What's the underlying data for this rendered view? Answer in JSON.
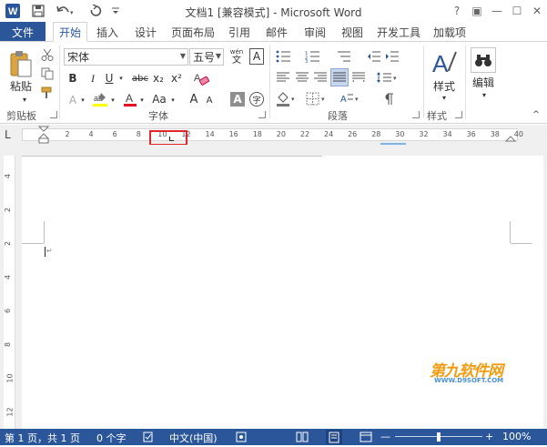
{
  "window": {
    "title": "文档1 [兼容模式] - Microsoft Word",
    "controls": [
      "?",
      "▣",
      "—",
      "☐",
      "✕"
    ]
  },
  "tabs": {
    "file": "文件",
    "items": [
      "开始",
      "插入",
      "设计",
      "页面布局",
      "引用",
      "邮件",
      "审阅",
      "视图",
      "开发工具",
      "加载项"
    ],
    "active_index": 0
  },
  "ribbon": {
    "clipboard": {
      "paste": "粘贴",
      "label": "剪贴板"
    },
    "font": {
      "family": "宋体",
      "size": "五号",
      "phonetic_top": "wén",
      "phonetic_bottom": "文",
      "border_char": "A",
      "bold": "B",
      "italic": "I",
      "underline": "U",
      "strike": "abc",
      "subscript": "x₂",
      "superscript": "x²",
      "grow": "A",
      "shrink": "A",
      "change_case": "Aa",
      "shade_char": "A",
      "enclose_char": "字",
      "label": "字体"
    },
    "paragraph": {
      "label": "段落"
    },
    "styles": {
      "button": "样式",
      "label": "样式"
    },
    "editing": {
      "button": "编辑"
    }
  },
  "ruler": {
    "corner": "L",
    "ticks": [
      "2",
      "4",
      "6",
      "8",
      "10",
      "12",
      "14",
      "16",
      "18",
      "20",
      "22",
      "24",
      "26",
      "28",
      "30",
      "32",
      "34",
      "36",
      "38",
      "40"
    ],
    "vertical": [
      "4",
      "2",
      "2",
      "4",
      "6",
      "8",
      "10",
      "12"
    ]
  },
  "status": {
    "page": "第 1 页，共 1 页",
    "words": "0 个字",
    "language": "中文(中国)",
    "zoom": "100%"
  },
  "watermark": {
    "line1": "第九软件网",
    "line2": "WWW.D9SOFT.COM"
  },
  "colors": {
    "accent": "#2b579a",
    "highlight": "#ffff00",
    "font_color": "#e81123",
    "tab_marker": "#e0262a"
  }
}
